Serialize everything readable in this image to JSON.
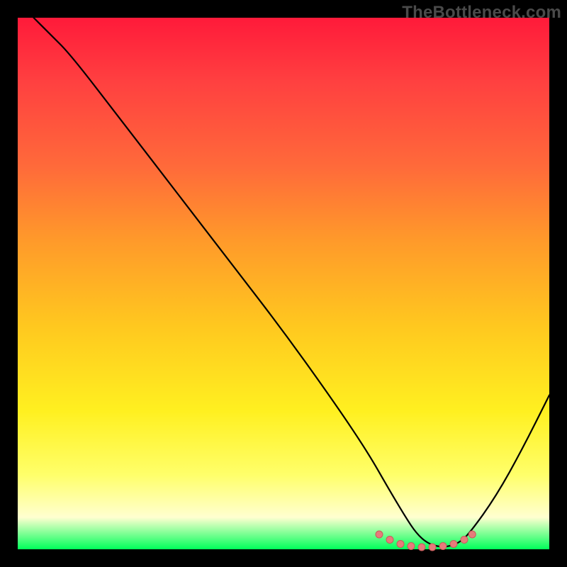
{
  "watermark": "TheBottleneck.com",
  "colors": {
    "bg": "#000000",
    "curve": "#000000",
    "dot_fill": "#e77b7b",
    "dot_stroke": "#c95a5a"
  },
  "chart_data": {
    "type": "line",
    "title": "",
    "xlabel": "",
    "ylabel": "",
    "xlim": [
      0,
      100
    ],
    "ylim": [
      0,
      100
    ],
    "series": [
      {
        "name": "bottleneck-curve",
        "x": [
          3,
          6,
          10,
          20,
          30,
          40,
          50,
          60,
          66,
          70,
          73,
          75,
          77,
          79,
          81,
          83,
          85,
          90,
          95,
          100
        ],
        "y": [
          100,
          97,
          93,
          80,
          67,
          54,
          41,
          27,
          18,
          11,
          6,
          3,
          1.2,
          0.5,
          0.5,
          1.2,
          3,
          10,
          19,
          29
        ]
      }
    ],
    "flat_markers": {
      "name": "valley-dots",
      "x": [
        68,
        70,
        72,
        74,
        76,
        78,
        80,
        82,
        84,
        85.5
      ],
      "y": [
        2.8,
        1.8,
        1.0,
        0.6,
        0.4,
        0.4,
        0.6,
        1.0,
        1.8,
        2.8
      ]
    }
  }
}
